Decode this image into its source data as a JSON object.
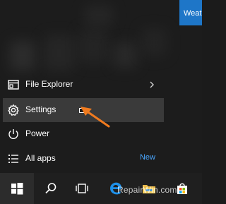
{
  "weather_tile": {
    "label": "Weat"
  },
  "menu": {
    "items": [
      {
        "label": "File Explorer",
        "icon": "file-explorer-icon",
        "has_submenu": true
      },
      {
        "label": "Settings",
        "icon": "gear-icon",
        "highlighted": true
      },
      {
        "label": "Power",
        "icon": "power-icon"
      },
      {
        "label": "All apps",
        "icon": "all-apps-icon",
        "badge": "New"
      }
    ]
  },
  "annotation": {
    "arrow_color": "#f07b1f",
    "points_to": "Settings"
  },
  "taskbar": {
    "buttons": [
      "windows-start-icon",
      "search-icon",
      "task-view-icon",
      "edge-icon",
      "file-explorer-icon",
      "store-icon"
    ]
  },
  "watermark": "RepairWin.com",
  "colors": {
    "accent": "#1e76c8",
    "badge": "#4aa7ff",
    "highlight": "#3a3a3a"
  }
}
